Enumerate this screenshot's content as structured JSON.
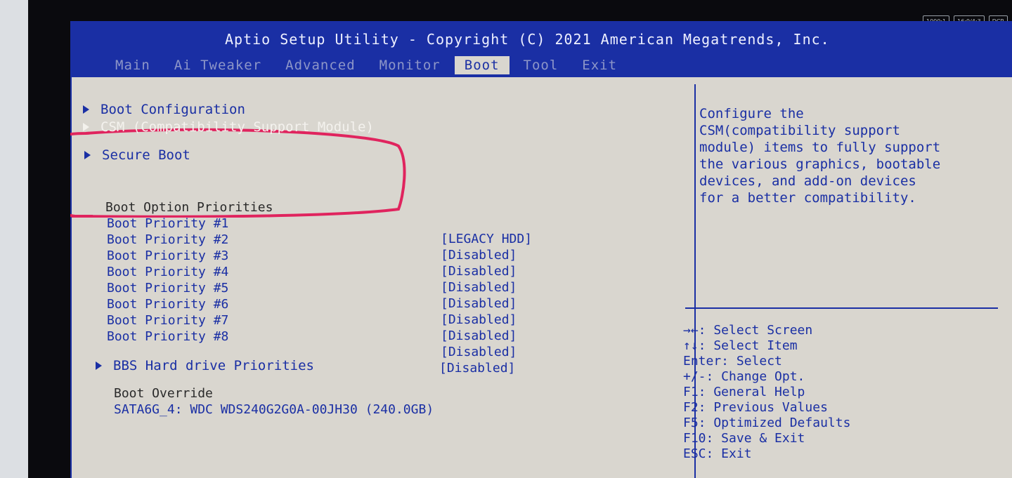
{
  "title": "Aptio Setup Utility - Copyright (C) 2021 American Megatrends, Inc.",
  "tabs": [
    "Main",
    "Ai Tweaker",
    "Advanced",
    "Monitor",
    "Boot",
    "Tool",
    "Exit"
  ],
  "active_tab": "Boot",
  "menu": {
    "boot_configuration": "Boot Configuration",
    "csm": "CSM (Compatibility Support Module)",
    "secure_boot": "Secure Boot",
    "bbs": "BBS Hard drive Priorities"
  },
  "boot_option_priorities": {
    "heading": "Boot Option Priorities",
    "items": [
      {
        "label": "Boot Priority #1",
        "value": "[LEGACY HDD]"
      },
      {
        "label": "Boot Priority #2",
        "value": "[Disabled]"
      },
      {
        "label": "Boot Priority #3",
        "value": "[Disabled]"
      },
      {
        "label": "Boot Priority #4",
        "value": "[Disabled]"
      },
      {
        "label": "Boot Priority #5",
        "value": "[Disabled]"
      },
      {
        "label": "Boot Priority #6",
        "value": "[Disabled]"
      },
      {
        "label": "Boot Priority #7",
        "value": "[Disabled]"
      },
      {
        "label": "Boot Priority #8",
        "value": "[Disabled]"
      }
    ],
    "extra_value": "[Disabled]"
  },
  "boot_override": {
    "heading": "Boot Override",
    "device": "SATA6G_4: WDC WDS240G2G0A-00JH30 (240.0GB)"
  },
  "help_text": "Configure the\nCSM(compatibility support\nmodule) items to fully support\nthe various graphics, bootable\ndevices, and add-on devices\nfor a better compatibility.",
  "keys": [
    "→←: Select Screen",
    "↑↓: Select Item",
    "Enter: Select",
    "+/-: Change Opt.",
    "F1: General Help",
    "F2: Previous Values",
    "F5: Optimized Defaults",
    "F10: Save & Exit",
    "ESC: Exit"
  ],
  "osd": [
    "1000:1",
    "16:9/4:3",
    "DCR"
  ],
  "colors": {
    "bios_blue": "#1a2fa4",
    "bios_bg": "#d9d6cf",
    "annotation": "#e0245e"
  }
}
